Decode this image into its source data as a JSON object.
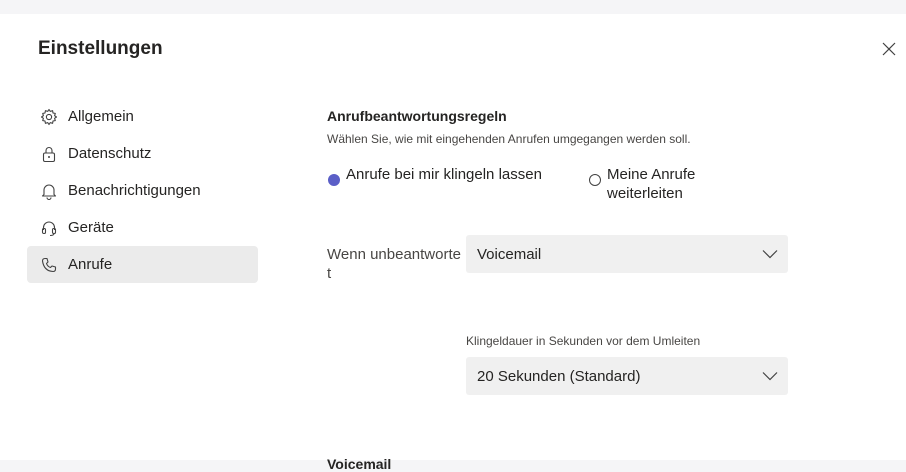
{
  "dialog": {
    "title": "Einstellungen",
    "close_icon": "close-icon"
  },
  "nav": {
    "items": [
      {
        "label": "Allgemein",
        "icon": "gear-icon"
      },
      {
        "label": "Datenschutz",
        "icon": "lock-icon"
      },
      {
        "label": "Benachrichtigungen",
        "icon": "bell-icon"
      },
      {
        "label": "Geräte",
        "icon": "headset-icon"
      },
      {
        "label": "Anrufe",
        "icon": "phone-icon",
        "active": true
      }
    ]
  },
  "calls": {
    "answer_rules_title": "Anrufbeantwortungsregeln",
    "answer_rules_desc": "Wählen Sie, wie mit eingehenden Anrufen umgegangen werden soll.",
    "option_ring": "Anrufe bei mir klingeln lassen",
    "option_forward": "Meine Anrufe weiterleiten",
    "unanswered_label": "Wenn unbeantwortet",
    "unanswered_value": "Voicemail",
    "ring_duration_label": "Klingeldauer in Sekunden vor dem Umleiten",
    "ring_duration_value": "20 Sekunden (Standard)",
    "voicemail_title": "Voicemail"
  },
  "colors": {
    "accent": "#5b5fc7",
    "active_nav_bg": "#ebebeb",
    "select_bg": "#f0f0f0"
  }
}
